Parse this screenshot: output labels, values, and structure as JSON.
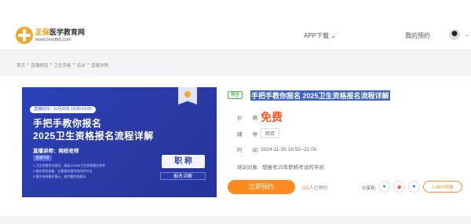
{
  "header": {
    "logo_brand": "正保",
    "logo_name": "医学教育网",
    "logo_url": "www.med66.com",
    "app_download": "APP下载",
    "my_reservation": "我的预约"
  },
  "breadcrumb": [
    "首页",
    ">",
    "直播频道",
    ">",
    "卫生资格",
    ">",
    "综合",
    ">",
    "直播详情"
  ],
  "banner": {
    "time": "直播时间：11月25日 19:00-21:00",
    "title_line1": "手把手教你报名",
    "title_line2": "2025卫生资格报名流程详解",
    "teacher": "直播讲师：网校老师",
    "content_tag": "直播内容",
    "lines": [
      "1.卫生资格考试报名，满足2025年卫生资格报名条件",
      "2.报名资料准备，注意报名细节的时间节点",
      "3.报名系统操作演示，按步骤完成报名"
    ],
    "job_label": "职 称",
    "job_sub": "报名详解"
  },
  "detail": {
    "status": "预告",
    "title": "手把手教你报名 2025卫生资格报名流程详解",
    "price_label": "价　　格:",
    "price": "免费",
    "category_label": "辅　　导:",
    "category": "综合",
    "time_label": "时　　间:",
    "time": "2024-11-25 18:55--21:00",
    "audience_label": "培训对象:",
    "audience": "想报考25年职称考试的学员",
    "reserve_button": "立即预约",
    "reserved_count": "119",
    "reserved_suffix": "人已预约",
    "share_label": "分享到:",
    "app_button": "APP观看"
  },
  "colors": {
    "accent": "#ff8a1f",
    "brand_blue": "#2a41b8",
    "free": "#ff5722"
  }
}
